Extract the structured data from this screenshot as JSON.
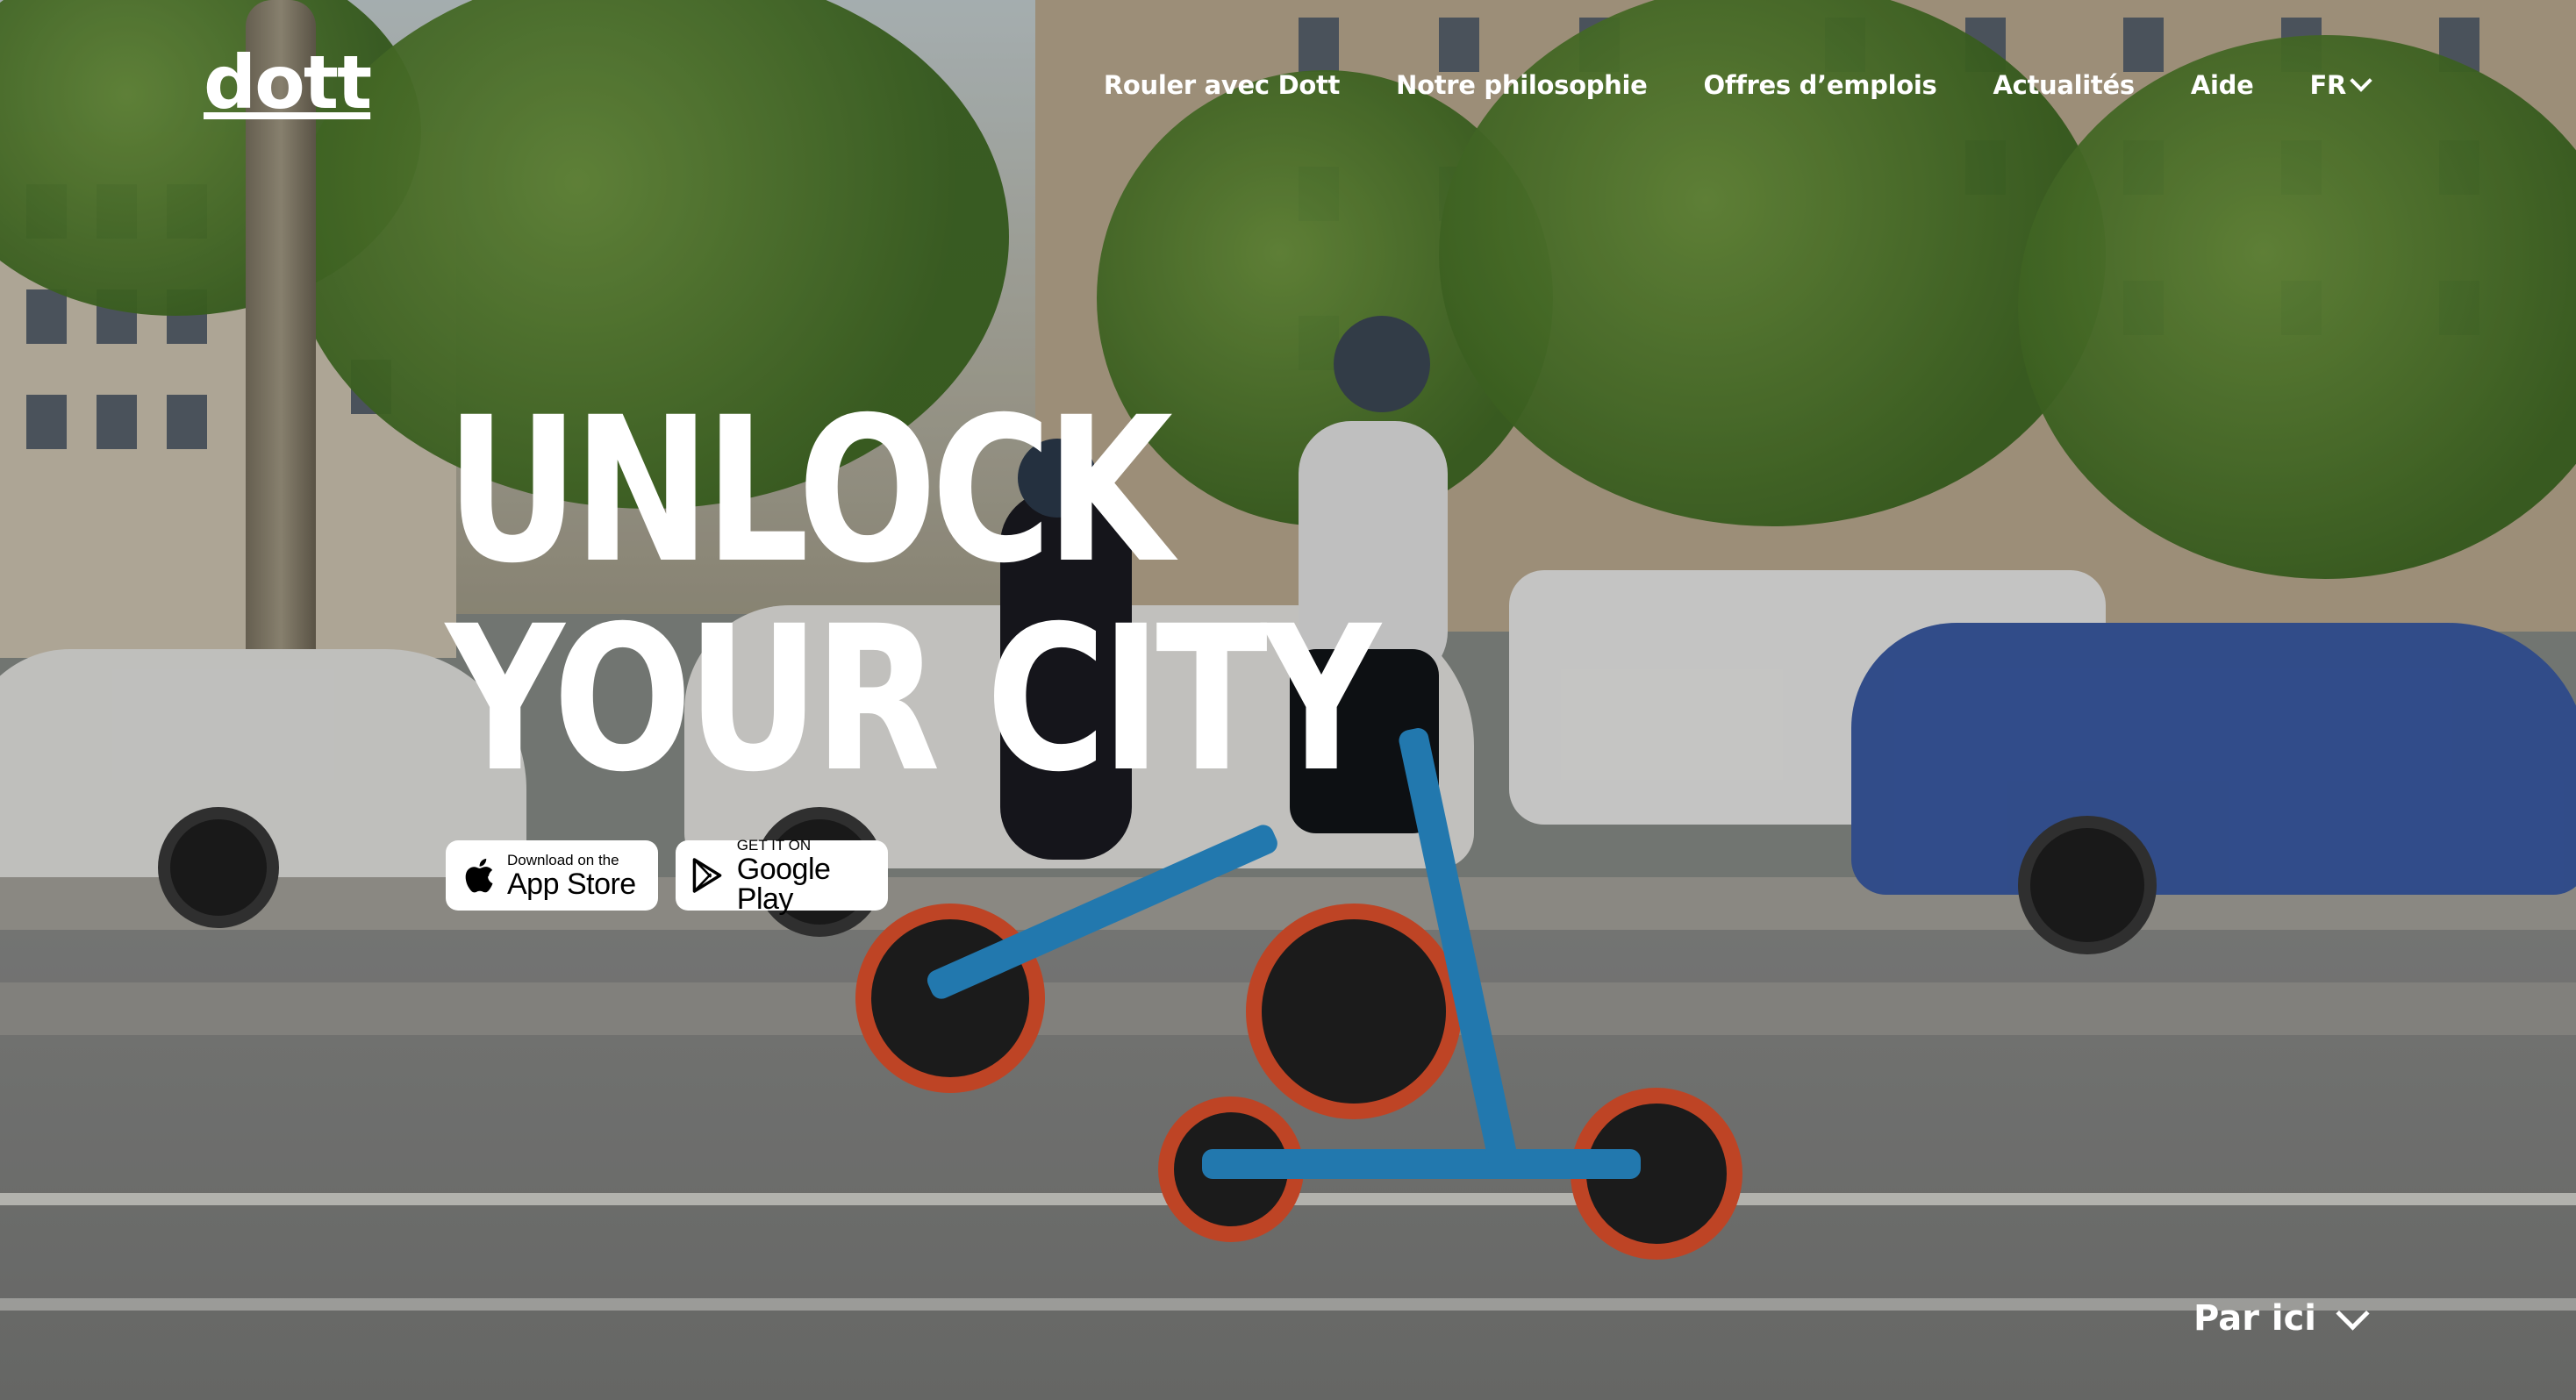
{
  "brand": {
    "logo_text": "dott"
  },
  "nav": {
    "items": [
      {
        "label": "Rouler avec Dott"
      },
      {
        "label": "Notre philosophie"
      },
      {
        "label": "Offres d’emplois"
      },
      {
        "label": "Actualités"
      },
      {
        "label": "Aide"
      }
    ],
    "language": {
      "label": "FR",
      "icon": "chevron-down-icon"
    }
  },
  "hero": {
    "headline_line1": "UNLOCK",
    "headline_line2": "YOUR CITY",
    "background": "street-scene-photo"
  },
  "stores": {
    "apple": {
      "small": "Download on the",
      "big": "App Store",
      "icon": "apple-icon"
    },
    "google": {
      "small": "GET IT ON",
      "big": "Google Play",
      "icon": "google-play-icon"
    }
  },
  "scroll_hint": {
    "label": "Par ici",
    "icon": "chevron-down-icon"
  },
  "colors": {
    "text": "#ffffff",
    "badge_bg": "#ffffff",
    "badge_text": "#000000",
    "vehicle_blue": "#2a93d5",
    "vehicle_red": "#e8542e"
  }
}
